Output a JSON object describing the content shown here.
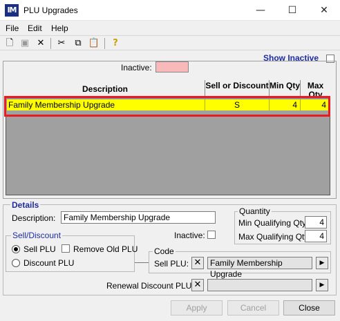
{
  "window": {
    "title": "PLU Upgrades",
    "icon_text": "IM",
    "minimize": "—",
    "maximize": "☐",
    "close": "✕"
  },
  "menu": {
    "file": "File",
    "edit": "Edit",
    "help": "Help"
  },
  "toolbar": {
    "icons": [
      "new-icon",
      "save-icon",
      "delete-icon",
      "cut-icon",
      "copy-icon",
      "paste-icon",
      "help-icon"
    ]
  },
  "list": {
    "show_inactive_label": "Show Inactive",
    "inactive_legend_label": "Inactive:",
    "inactive_color": "#f7b9b9",
    "columns": {
      "description": "Description",
      "sell_or_discount": "Sell or Discount",
      "min_qty": "Min Qty",
      "max_qty": "Max Qty"
    },
    "rows": [
      {
        "description": "Family Membership Upgrade",
        "sell_or_discount": "S",
        "min_qty": "4",
        "max_qty": "4"
      }
    ],
    "selected_row_color": "#ffff00",
    "highlight_color": "#e81b23"
  },
  "details": {
    "title": "Details",
    "description_label": "Description:",
    "description_value": "Family Membership Upgrade",
    "inactive_label": "Inactive:",
    "quantity": {
      "title": "Quantity",
      "min_label": "Min Qualifying Qty:",
      "min_value": "4",
      "max_label": "Max Qualifying Qty:",
      "max_value": "4"
    },
    "sell_discount": {
      "title": "Sell/Discount",
      "sell_plu_label": "Sell PLU",
      "remove_old_plu_label": "Remove Old PLU",
      "discount_plu_label": "Discount PLU"
    },
    "code": {
      "title": "Code",
      "sell_plu_label": "Sell PLU:",
      "sell_plu_value": "Family Membership Upgrade"
    },
    "renewal_discount_label": "Renewal Discount PLU:",
    "renewal_discount_value": ""
  },
  "buttons": {
    "apply": "Apply",
    "cancel": "Cancel",
    "close": "Close"
  }
}
